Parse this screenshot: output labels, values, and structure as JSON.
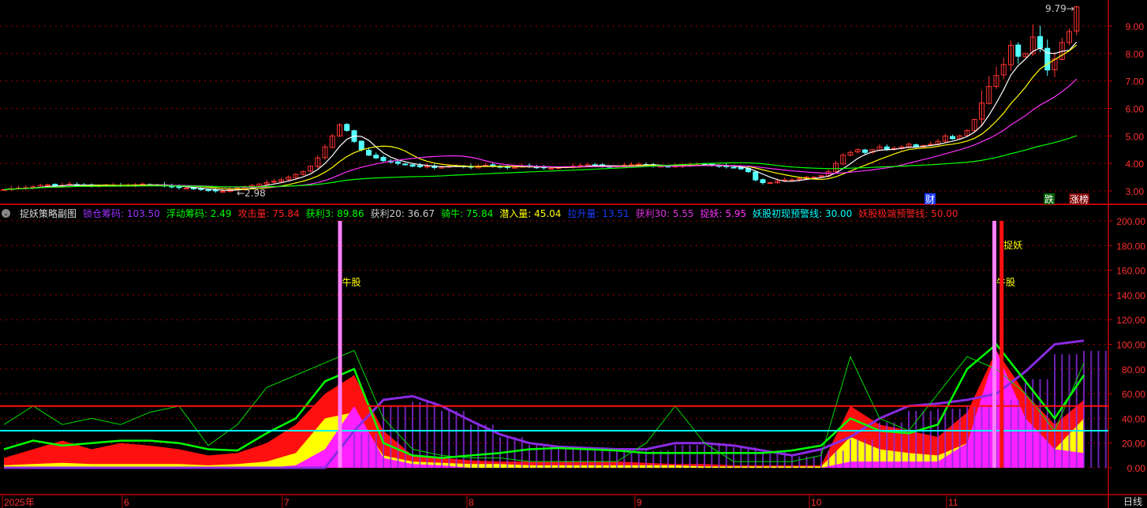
{
  "panel_title": "捉妖策略副图",
  "period_label": "日线",
  "indicators": [
    {
      "label": "锁仓筹码: 103.50",
      "color": "#9b30ff"
    },
    {
      "label": "浮动筹码: 2.49",
      "color": "#00ff00"
    },
    {
      "label": "攻击量: 75.84",
      "color": "#ff2020"
    },
    {
      "label": "获利3: 89.86",
      "color": "#00ff00"
    },
    {
      "label": "获利20: 36.67",
      "color": "#cccccc"
    },
    {
      "label": "骑牛: 75.84",
      "color": "#00ff00"
    },
    {
      "label": "潜入量: 45.04",
      "color": "#ffff00"
    },
    {
      "label": "拉升量: 13.51",
      "color": "#1a3cff"
    },
    {
      "label": "获利30: 5.55",
      "color": "#e030e0"
    },
    {
      "label": "捉妖: 5.95",
      "color": "#ff30ff"
    },
    {
      "label": "妖股初现预警线: 30.00",
      "color": "#00ffff"
    },
    {
      "label": "妖股极端预警线: 50.00",
      "color": "#ff2020"
    }
  ],
  "chart_data": [
    {
      "type": "candlestick",
      "title": "price",
      "yticks": [
        "3.00",
        "4.00",
        "5.00",
        "6.00",
        "7.00",
        "8.00",
        "9.00"
      ],
      "ylim": [
        2.7,
        9.9
      ],
      "xticks": [
        "2025年",
        "6",
        "7",
        "8",
        "9",
        "10",
        "11"
      ],
      "annotations": {
        "low": "2.98",
        "high": "9.79",
        "badges": [
          "财",
          "跌",
          "涨榜"
        ]
      },
      "closes": [
        3.05,
        3.08,
        3.1,
        3.12,
        3.15,
        3.2,
        3.22,
        3.18,
        3.2,
        3.25,
        3.22,
        3.2,
        3.18,
        3.2,
        3.22,
        3.2,
        3.18,
        3.2,
        3.22,
        3.25,
        3.22,
        3.2,
        3.18,
        3.15,
        3.12,
        3.1,
        3.08,
        3.05,
        3.02,
        3.0,
        2.98,
        3.05,
        3.1,
        3.15,
        3.2,
        3.25,
        3.3,
        3.35,
        3.4,
        3.5,
        3.6,
        3.7,
        3.9,
        4.2,
        4.6,
        5.0,
        5.4,
        5.2,
        4.8,
        4.5,
        4.3,
        4.2,
        4.1,
        4.05,
        4.0,
        3.95,
        3.9,
        3.88,
        3.9,
        3.85,
        3.87,
        3.9,
        3.92,
        3.88,
        3.86,
        3.9,
        3.93,
        3.9,
        3.88,
        3.85,
        3.87,
        3.9,
        3.88,
        3.86,
        3.84,
        3.82,
        3.85,
        3.88,
        3.9,
        3.92,
        3.95,
        3.93,
        3.9,
        3.88,
        3.9,
        3.93,
        3.95,
        3.97,
        3.95,
        3.92,
        3.9,
        3.88,
        3.9,
        3.93,
        3.95,
        3.97,
        3.95,
        3.93,
        3.9,
        3.88,
        3.85,
        3.8,
        3.7,
        3.4,
        3.3,
        3.3,
        3.35,
        3.4,
        3.4,
        3.45,
        3.5,
        3.5,
        3.55,
        3.7,
        4.0,
        4.3,
        4.4,
        4.5,
        4.4,
        4.5,
        4.6,
        4.5,
        4.55,
        4.6,
        4.7,
        4.6,
        4.65,
        4.7,
        4.8,
        5.0,
        4.9,
        5.0,
        5.2,
        5.6,
        6.2,
        6.8,
        7.2,
        7.6,
        8.3,
        7.9,
        8.0,
        8.6,
        8.2,
        7.4,
        7.8,
        8.4,
        8.8,
        9.7
      ],
      "ma_periods": [
        5,
        10,
        20,
        60
      ]
    },
    {
      "type": "area",
      "title": "捉妖策略副图",
      "ylim": [
        0,
        200
      ],
      "yticks": [
        "0.00",
        "20.00",
        "40.00",
        "60.00",
        "80.00",
        "100.00",
        "120.00",
        "140.00",
        "160.00",
        "180.00",
        "200.00"
      ],
      "sample_every_days": 4,
      "series": [
        {
          "name": "攻击量",
          "values": [
            8,
            15,
            22,
            15,
            20,
            18,
            15,
            10,
            12,
            20,
            35,
            60,
            75,
            30,
            10,
            8,
            6,
            5,
            5,
            5,
            5,
            5,
            4,
            3,
            3,
            2,
            2,
            2,
            2,
            50,
            35,
            30,
            25,
            45,
            95,
            60,
            35,
            55
          ]
        },
        {
          "name": "潜入量",
          "values": [
            2,
            3,
            4,
            3,
            3,
            3,
            3,
            2,
            3,
            5,
            12,
            40,
            45,
            10,
            5,
            4,
            3,
            3,
            2,
            2,
            2,
            2,
            2,
            2,
            1,
            1,
            1,
            1,
            1,
            25,
            15,
            12,
            10,
            20,
            60,
            30,
            15,
            40
          ]
        },
        {
          "name": "捉妖",
          "values": [
            0,
            0,
            0,
            0,
            0,
            0,
            0,
            0,
            0,
            0,
            2,
            15,
            50,
            8,
            3,
            2,
            0,
            0,
            0,
            0,
            0,
            0,
            0,
            0,
            0,
            0,
            0,
            0,
            0,
            5,
            5,
            5,
            5,
            20,
            95,
            40,
            15,
            12
          ]
        },
        {
          "name": "锁仓筹码",
          "values": [
            0,
            0,
            0,
            0,
            0,
            0,
            0,
            0,
            0,
            0,
            0,
            0,
            30,
            55,
            58,
            50,
            38,
            27,
            20,
            17,
            16,
            15,
            15,
            20,
            20,
            18,
            14,
            10,
            15,
            25,
            40,
            50,
            52,
            55,
            60,
            78,
            100,
            103
          ]
        },
        {
          "name": "浮动筹码",
          "values": [
            35,
            50,
            35,
            40,
            35,
            45,
            50,
            18,
            35,
            65,
            75,
            85,
            95,
            40,
            15,
            10,
            8,
            8,
            5,
            5,
            5,
            5,
            20,
            50,
            20,
            5,
            5,
            5,
            10,
            90,
            40,
            30,
            60,
            90,
            80,
            60,
            30,
            85
          ]
        },
        {
          "name": "获利3",
          "values": [
            15,
            22,
            18,
            20,
            22,
            22,
            20,
            15,
            14,
            28,
            40,
            70,
            80,
            20,
            10,
            8,
            10,
            12,
            15,
            16,
            15,
            14,
            12,
            12,
            12,
            12,
            12,
            14,
            18,
            40,
            30,
            28,
            35,
            80,
            100,
            70,
            40,
            75
          ]
        }
      ],
      "reference_lines": [
        {
          "name": "妖股初现预警线",
          "value": 30
        },
        {
          "name": "妖股极端预警线",
          "value": 50
        }
      ],
      "signals": [
        {
          "label": "牛股",
          "day": 46
        },
        {
          "label": "牛股",
          "day": 136
        },
        {
          "label": "捉妖",
          "day": 137
        }
      ]
    }
  ]
}
